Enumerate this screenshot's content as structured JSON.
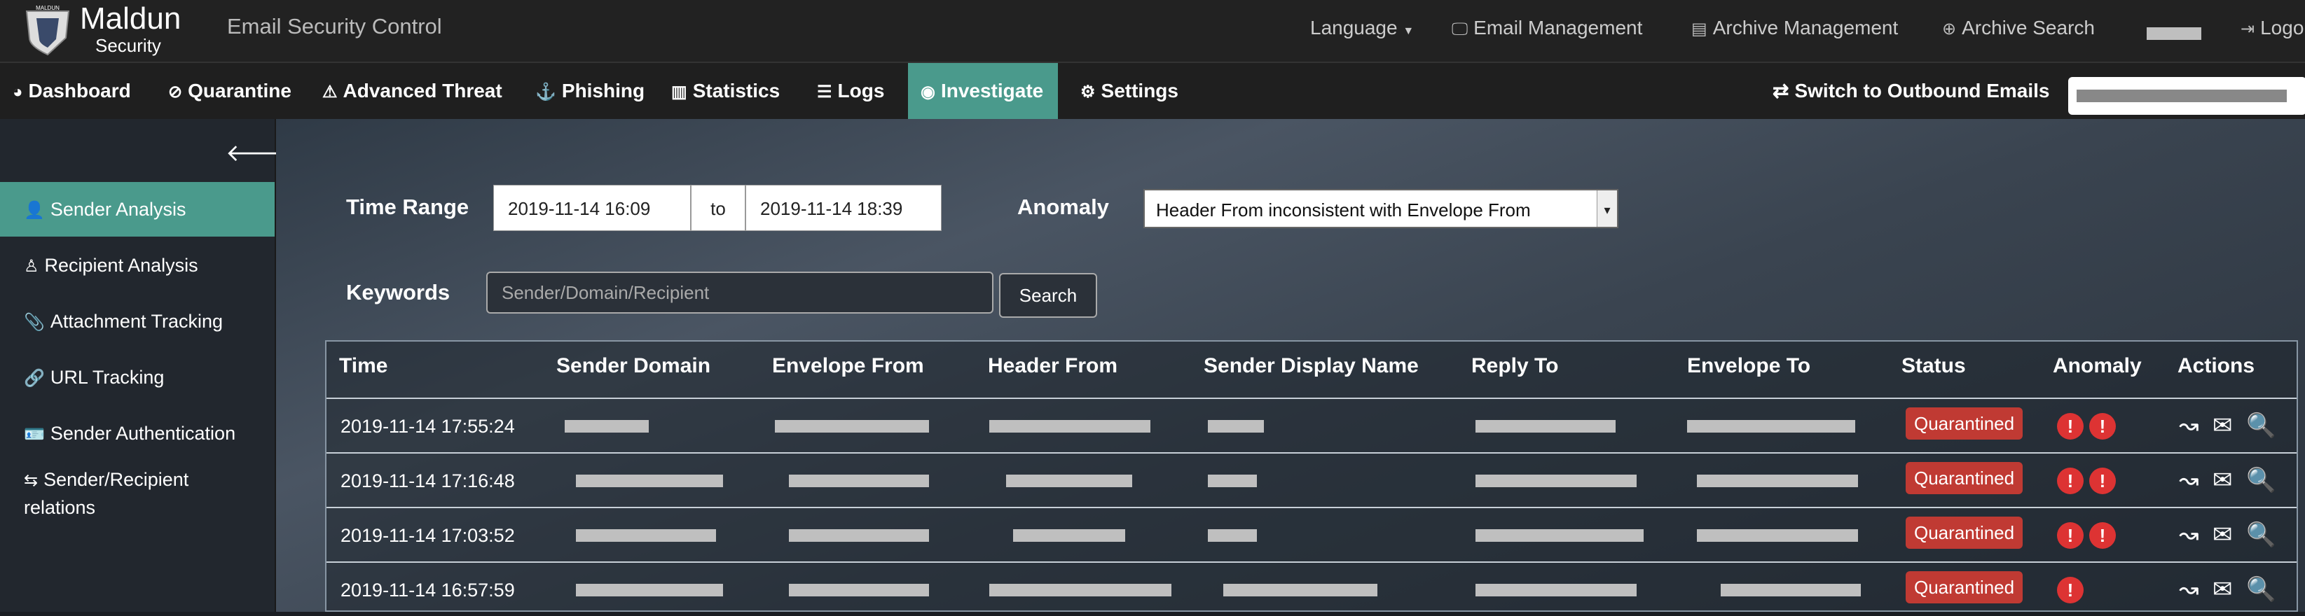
{
  "header": {
    "brand": "Maldun",
    "brand_sub": "Security",
    "logo_text": "MALDUN",
    "app_title": "Email Security Control",
    "language": "Language",
    "email_mgmt": "Email Management",
    "archive_mgmt": "Archive Management",
    "archive_search": "Archive Search",
    "logout": "Logo"
  },
  "nav": {
    "items": [
      "Dashboard",
      "Quarantine",
      "Advanced Threat",
      "Phishing",
      "Statistics",
      "Logs",
      "Investigate",
      "Settings"
    ],
    "active": "Investigate",
    "switch": "Switch to Outbound Emails"
  },
  "sidebar": {
    "items": [
      "Sender Analysis",
      "Recipient Analysis",
      "Attachment Tracking",
      "URL Tracking",
      "Sender Authentication",
      "Sender/Recipient",
      "relations"
    ]
  },
  "filters": {
    "time_range_label": "Time Range",
    "start": "2019-11-14 16:09",
    "to": "to",
    "end": "2019-11-14 18:39",
    "anomaly_label": "Anomaly",
    "anomaly_value": "Header From inconsistent with Envelope From",
    "keywords_label": "Keywords",
    "keywords_placeholder": "Sender/Domain/Recipient",
    "search": "Search"
  },
  "table": {
    "columns": [
      "Time",
      "Sender Domain",
      "Envelope From",
      "Header From",
      "Sender Display Name",
      "Reply To",
      "Envelope To",
      "Status",
      "Anomaly",
      "Actions"
    ],
    "rows": [
      {
        "time": "2019-11-14 17:55:24",
        "status": "Quarantined",
        "anomaly_count": 2
      },
      {
        "time": "2019-11-14 17:16:48",
        "status": "Quarantined",
        "anomaly_count": 2
      },
      {
        "time": "2019-11-14 17:03:52",
        "status": "Quarantined",
        "anomaly_count": 2
      },
      {
        "time": "2019-11-14 16:57:59",
        "status": "Quarantined",
        "anomaly_count": 1
      }
    ]
  },
  "colors": {
    "accent": "#4a9a8c",
    "badge": "#c03a33",
    "alert": "#dd3333"
  }
}
